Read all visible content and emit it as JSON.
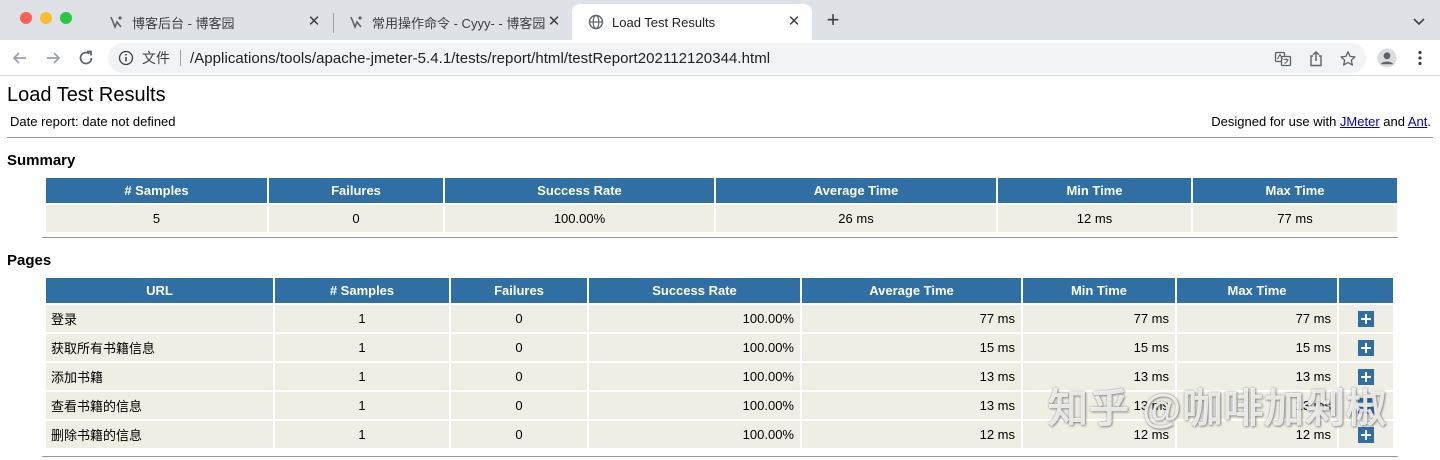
{
  "browser": {
    "tabs": [
      {
        "title": "博客后台 - 博客园",
        "close": "✕",
        "icon": "cnblogs-icon"
      },
      {
        "title": "常用操作命令 - Cyyy- - 博客园",
        "close": "✕",
        "icon": "cnblogs-icon"
      },
      {
        "title": "Load Test Results",
        "close": "✕",
        "icon": "globe-icon"
      }
    ],
    "newtab": "+",
    "address": {
      "label": "文件",
      "url": "/Applications/tools/apache-jmeter-5.4.1/tests/report/html/testReport202112120344.html"
    }
  },
  "page": {
    "title": "Load Test Results",
    "date_report": "Date report: date not defined",
    "designed_prefix": "Designed for use with ",
    "jmeter_link": "JMeter",
    "designed_and": " and ",
    "ant_link": "Ant",
    "designed_suffix": "."
  },
  "summary": {
    "heading": "Summary",
    "headers": [
      "# Samples",
      "Failures",
      "Success Rate",
      "Average Time",
      "Min Time",
      "Max Time"
    ],
    "row": [
      "5",
      "0",
      "100.00%",
      "26 ms",
      "12 ms",
      "77 ms"
    ]
  },
  "pages": {
    "heading": "Pages",
    "headers": [
      "URL",
      "# Samples",
      "Failures",
      "Success Rate",
      "Average Time",
      "Min Time",
      "Max Time",
      ""
    ],
    "rows": [
      [
        "登录",
        "1",
        "0",
        "100.00%",
        "77 ms",
        "77 ms",
        "77 ms"
      ],
      [
        "获取所有书籍信息",
        "1",
        "0",
        "100.00%",
        "15 ms",
        "15 ms",
        "15 ms"
      ],
      [
        "添加书籍",
        "1",
        "0",
        "100.00%",
        "13 ms",
        "13 ms",
        "13 ms"
      ],
      [
        "查看书籍的信息",
        "1",
        "0",
        "100.00%",
        "13 ms",
        "13 ms",
        "13 ms"
      ],
      [
        "删除书籍的信息",
        "1",
        "0",
        "100.00%",
        "12 ms",
        "12 ms",
        "12 ms"
      ]
    ]
  },
  "watermark": "知乎 @咖啡加剁椒",
  "colors": {
    "table_header": "#2f6fa3",
    "table_cell": "#eeeee4",
    "link": "#0000cc"
  }
}
